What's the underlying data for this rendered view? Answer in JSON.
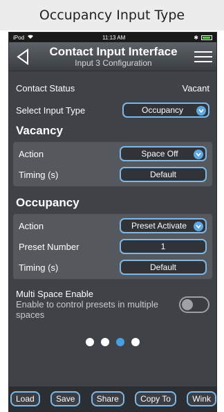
{
  "caption": "Occupancy Input Type",
  "statusbar": {
    "device": "iPod",
    "time": "11:13 AM",
    "bluetooth": "✱"
  },
  "navbar": {
    "title": "Contact Input Interface",
    "subtitle": "Input 3 Configuration"
  },
  "contact_status": {
    "label": "Contact Status",
    "value": "Vacant"
  },
  "input_type": {
    "label": "Select Input Type",
    "value": "Occupancy"
  },
  "vacancy": {
    "title": "Vacancy",
    "action_label": "Action",
    "action_value": "Space Off",
    "timing_label": "Timing (s)",
    "timing_value": "Default"
  },
  "occupancy": {
    "title": "Occupancy",
    "action_label": "Action",
    "action_value": "Preset Activate",
    "preset_label": "Preset Number",
    "preset_value": "1",
    "timing_label": "Timing (s)",
    "timing_value": "Default"
  },
  "multi_space": {
    "label": "Multi Space Enable",
    "description": "Enable to control presets in multiple spaces",
    "enabled": false
  },
  "pager": {
    "count": 4,
    "active_index": 2
  },
  "footer": {
    "load": "Load",
    "save": "Save",
    "share": "Share",
    "copy_to": "Copy To",
    "wink": "Wink"
  },
  "colors": {
    "accent": "#7fb8e6",
    "dot_active": "#4a9fe0",
    "background": "#3f4348"
  }
}
